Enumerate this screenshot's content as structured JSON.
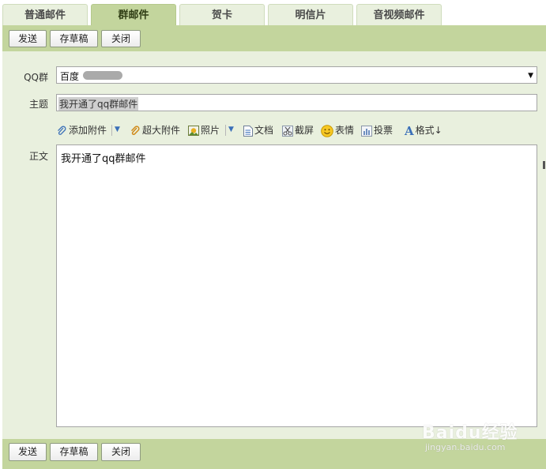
{
  "tabs": [
    {
      "label": "普通邮件",
      "active": false
    },
    {
      "label": "群邮件",
      "active": true
    },
    {
      "label": "贺卡",
      "active": false
    },
    {
      "label": "明信片",
      "active": false
    },
    {
      "label": "音视频邮件",
      "active": false
    }
  ],
  "toolbar": {
    "send_label": "发送",
    "draft_label": "存草稿",
    "close_label": "关闭"
  },
  "form": {
    "group_label": "QQ群",
    "group_value": "百度",
    "subject_label": "主题",
    "subject_value": "我开通了qq群邮件",
    "body_label": "正文",
    "body_value": "我开通了qq群邮件"
  },
  "attach_bar": {
    "add_attachment": "添加附件",
    "large_attachment": "超大附件",
    "photo": "照片",
    "document": "文档",
    "screenshot": "截屏",
    "emoticon": "表情",
    "vote": "投票",
    "format": "格式↓"
  },
  "watermark": {
    "logo": "Baidu经验",
    "url": "jingyan.baidu.com"
  },
  "colors": {
    "toolbar_green": "#c3d59d",
    "form_bg": "#e9f0de",
    "icon_blue": "#3a6fb8"
  }
}
